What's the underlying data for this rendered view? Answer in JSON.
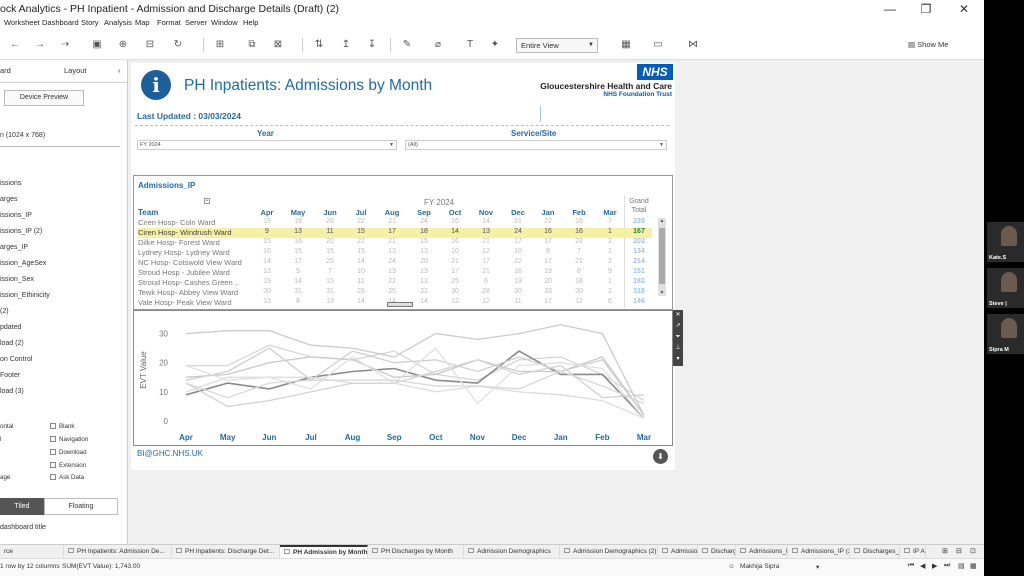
{
  "window": {
    "title": "ock Analytics - PH Inpatient - Admission and Discharge Details (Draft) (2)",
    "controls": [
      "—",
      "❐",
      "✕"
    ]
  },
  "menu": [
    "Worksheet",
    "Dashboard",
    "Story",
    "Analysis",
    "Map",
    "Format",
    "Server",
    "Window",
    "Help"
  ],
  "toolbar": {
    "fit_value": "Entire View",
    "show_me": "Show Me"
  },
  "left_panel": {
    "tab_dashboard": "ard",
    "tab_layout": "Layout",
    "collapse": "‹",
    "device_preview": "Device Preview",
    "size": "n (1024 x 768)",
    "sheets": [
      "issions",
      "arges",
      "issions_IP",
      "issions_IP (2)",
      "arges_IP",
      "ission_AgeSex",
      "ission_Sex",
      "ission_Ethinicity",
      "(2)",
      "pdated",
      "load (2)",
      "on Control",
      "Footer",
      "load (3)"
    ],
    "objects": {
      "left": [
        "ontal",
        "l",
        "",
        "",
        "age"
      ],
      "right": [
        "Blank",
        "Navigation",
        "Download",
        "Extension",
        "Ask Data"
      ]
    },
    "tiled": "Tiled",
    "floating": "Floating",
    "dashboard_title": "dashboard title"
  },
  "dashboard": {
    "info_icon": "i",
    "title": "PH Inpatients: Admissions by Month",
    "nhs": "NHS",
    "org_line1": "Gloucestershire Health and Care",
    "org_line2": "NHS Foundation Trust",
    "last_updated": "Last Updated : 03/03/2024",
    "filters": {
      "year_label": "Year",
      "year_value": "FY 2024",
      "service_label": "Service/Site",
      "service_value": "(All)"
    },
    "table": {
      "title": "Admissions_IP",
      "fy": "FY 2024",
      "team_header": "Team",
      "months": [
        "Apr",
        "May",
        "Jun",
        "Jul",
        "Aug",
        "Sep",
        "Oct",
        "Nov",
        "Dec",
        "Jan",
        "Feb",
        "Mar"
      ],
      "grand_total_1": "Grand",
      "grand_total_2": "Total",
      "rows": [
        {
          "team": "Ciren Hosp- Coln Ward",
          "values": [
            "19",
            "19",
            "26",
            "22",
            "21",
            "24",
            "16",
            "14",
            "21",
            "22",
            "16",
            "7"
          ],
          "total": "239",
          "highlight": false
        },
        {
          "team": "Ciren Hosp- Windrush Ward",
          "values": [
            "9",
            "13",
            "11",
            "15",
            "17",
            "18",
            "14",
            "13",
            "24",
            "16",
            "16",
            "1"
          ],
          "total": "167",
          "highlight": true
        },
        {
          "team": "Dilke Hosp- Forest Ward",
          "values": [
            "15",
            "16",
            "20",
            "22",
            "21",
            "15",
            "16",
            "21",
            "17",
            "17",
            "22",
            "2"
          ],
          "total": "202",
          "highlight": false
        },
        {
          "team": "Lydney Hosp- Lydney Ward",
          "values": [
            "10",
            "15",
            "15",
            "15",
            "13",
            "13",
            "10",
            "12",
            "10",
            "9",
            "7",
            "1"
          ],
          "total": "134",
          "highlight": false
        },
        {
          "team": "NC Hosp- Cotswold View Ward",
          "values": [
            "14",
            "17",
            "25",
            "14",
            "24",
            "20",
            "21",
            "17",
            "22",
            "17",
            "21",
            "2"
          ],
          "total": "214",
          "highlight": false
        },
        {
          "team": "Stroud Hosp - Jubilee Ward",
          "values": [
            "13",
            "5",
            "7",
            "10",
            "13",
            "13",
            "17",
            "21",
            "16",
            "19",
            "8",
            "9"
          ],
          "total": "151",
          "highlight": false
        },
        {
          "team": "Stroud Hosp- Cashes Green ..",
          "values": [
            "19",
            "14",
            "15",
            "11",
            "22",
            "13",
            "25",
            "6",
            "19",
            "20",
            "18",
            "1"
          ],
          "total": "182",
          "highlight": false
        },
        {
          "team": "Tewk Hosp- Abbey View Ward",
          "values": [
            "30",
            "31",
            "31",
            "26",
            "25",
            "22",
            "30",
            "28",
            "30",
            "33",
            "30",
            "2"
          ],
          "total": "318",
          "highlight": false
        },
        {
          "team": "Vale Hosp- Peak View Ward",
          "values": [
            "13",
            "8",
            "13",
            "14",
            "14",
            "14",
            "12",
            "12",
            "11",
            "17",
            "12",
            "6"
          ],
          "total": "146",
          "highlight": false
        }
      ]
    },
    "chart_labels": {
      "ylabel": "EVT Value",
      "yticks": [
        "0",
        "10",
        "20",
        "30"
      ]
    },
    "email": "BI@GHC.NHS.UK",
    "download_icon": "⬇"
  },
  "chart_data": {
    "type": "line",
    "x": [
      "Apr",
      "May",
      "Jun",
      "Jul",
      "Aug",
      "Sep",
      "Oct",
      "Nov",
      "Dec",
      "Jan",
      "Feb",
      "Mar"
    ],
    "ylabel": "EVT Value",
    "ylim": [
      0,
      35
    ],
    "yticks": [
      0,
      10,
      20,
      30
    ],
    "highlight_series": "Ciren Hosp- Windrush Ward",
    "series": [
      {
        "name": "Ciren Hosp- Coln Ward",
        "values": [
          19,
          19,
          26,
          22,
          21,
          24,
          16,
          14,
          21,
          22,
          16,
          7
        ]
      },
      {
        "name": "Ciren Hosp- Windrush Ward",
        "values": [
          9,
          13,
          11,
          15,
          17,
          18,
          14,
          13,
          24,
          16,
          16,
          1
        ]
      },
      {
        "name": "Dilke Hosp- Forest Ward",
        "values": [
          15,
          16,
          20,
          22,
          21,
          15,
          16,
          21,
          17,
          17,
          22,
          2
        ]
      },
      {
        "name": "Lydney Hosp- Lydney Ward",
        "values": [
          10,
          15,
          15,
          15,
          13,
          13,
          10,
          12,
          10,
          9,
          7,
          1
        ]
      },
      {
        "name": "NC Hosp- Cotswold View Ward",
        "values": [
          14,
          17,
          25,
          14,
          24,
          20,
          21,
          17,
          22,
          17,
          21,
          2
        ]
      },
      {
        "name": "Stroud Hosp - Jubilee Ward",
        "values": [
          13,
          5,
          7,
          10,
          13,
          13,
          17,
          21,
          16,
          19,
          8,
          9
        ]
      },
      {
        "name": "Stroud Hosp- Cashes Green ..",
        "values": [
          19,
          14,
          15,
          11,
          22,
          13,
          25,
          6,
          19,
          20,
          18,
          1
        ]
      },
      {
        "name": "Tewk Hosp- Abbey View Ward",
        "values": [
          30,
          31,
          31,
          26,
          25,
          22,
          30,
          28,
          30,
          33,
          30,
          2
        ]
      },
      {
        "name": "Vale Hosp- Peak View Ward",
        "values": [
          13,
          8,
          13,
          14,
          14,
          14,
          12,
          12,
          11,
          17,
          12,
          6
        ]
      }
    ]
  },
  "sheet_tabs": [
    {
      "label": "rce",
      "active": false
    },
    {
      "label": "PH Inpatients: Admission De...",
      "active": false
    },
    {
      "label": "PH Inpatients: Discharge Det...",
      "active": false
    },
    {
      "label": "PH Admission by Month",
      "active": true
    },
    {
      "label": "PH Discharges by Month",
      "active": false
    },
    {
      "label": "Admission Demographics",
      "active": false
    },
    {
      "label": "Admission Demographics (2)",
      "active": false
    },
    {
      "label": "Admissions",
      "active": false
    },
    {
      "label": "Discharges",
      "active": false
    },
    {
      "label": "Admissions_IP",
      "active": false
    },
    {
      "label": "Admissions_IP (2)",
      "active": false
    },
    {
      "label": "Discharges_IP",
      "active": false
    },
    {
      "label": "IP Adm",
      "active": false
    }
  ],
  "status": {
    "rows_cols": "1 row by 12 columns",
    "sum": "SUM(EVT Value): 1,743.00",
    "user": "Makhija Sipra"
  },
  "participants": [
    {
      "name": "Kate.S"
    },
    {
      "name": "Steve |"
    },
    {
      "name": "Sipra M"
    }
  ]
}
